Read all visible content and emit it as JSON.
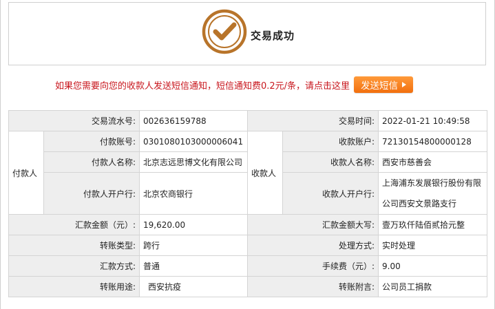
{
  "header": {
    "status_text": "交易成功",
    "status_icon": "check-circle-icon",
    "accent_color": "#b8742a"
  },
  "sms": {
    "notice_text": "如果您需要向您的收款人发送短信通知，短信通知费0.2元/条，请点击这里",
    "button_label": "发送短信",
    "notice_color": "#c8161d",
    "button_color": "#f58220"
  },
  "details": {
    "serial_label": "交易流水号:",
    "serial_value": "002636159788",
    "time_label": "交易时间:",
    "time_value": "2022-01-21 10:49:58",
    "payer_group": "付款人",
    "payer_account_label": "付款账号:",
    "payer_account_value": "0301080103000006041",
    "payer_name_label": "付款人名称:",
    "payer_name_value": "北京志远思博文化有限公司",
    "payer_bank_label": "付款人开户行:",
    "payer_bank_value": "北京农商银行",
    "payee_group": "收款人",
    "payee_account_label": "收款账户:",
    "payee_account_value": "72130154800000128",
    "payee_name_label": "收款人名称:",
    "payee_name_value": "西安市慈善会",
    "payee_bank_label": "收款人开户行:",
    "payee_bank_line1": "上海浦东发展银行股份有限",
    "payee_bank_line2": "公司西安文景路支行",
    "amount_label": "汇款金额（元）:",
    "amount_value": "19,620.00",
    "amount_upper_label": "汇款金额大写:",
    "amount_upper_value": "壹万玖仟陆佰贰拾元整",
    "transfer_type_label": "转账类型:",
    "transfer_type_value": "跨行",
    "process_label": "处理方式:",
    "process_value": "实时处理",
    "remit_method_label": "汇款方式:",
    "remit_method_value": "普通",
    "fee_label": "手续费（元）:",
    "fee_value": "9.00",
    "purpose_label": "转账用途:",
    "purpose_value": "西安抗疫",
    "memo_label": "转账附言:",
    "memo_value": "公司员工捐款"
  }
}
